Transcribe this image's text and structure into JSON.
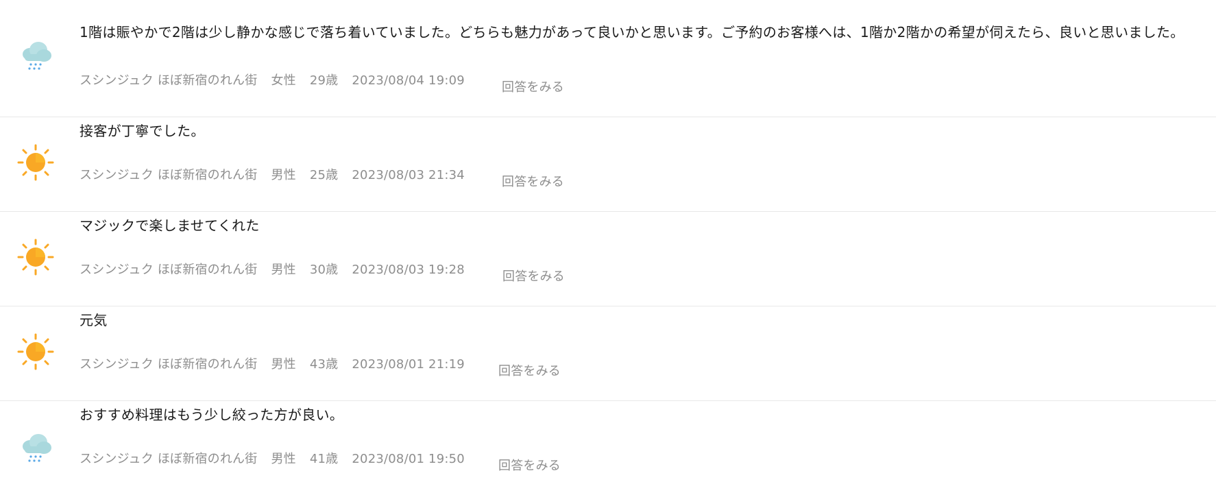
{
  "feedback": [
    {
      "weather": "rain-cloud-icon",
      "comment": "1階は賑やかで2階は少し静かな感じで落ち着いていました。どちらも魅力があって良いかと思います。ご予約のお客様へは、1階か2階かの希望が伺えたら、良いと思いました。",
      "store": "スシンジュク ほぼ新宿のれん街",
      "gender": "女性",
      "age": "29歳",
      "date": "2023/08/04 19:09",
      "answer_label": "回答をみる"
    },
    {
      "weather": "sun-icon",
      "comment": "接客が丁寧でした。",
      "store": "スシンジュク ほぼ新宿のれん街",
      "gender": "男性",
      "age": "25歳",
      "date": "2023/08/03 21:34",
      "answer_label": "回答をみる"
    },
    {
      "weather": "sun-icon",
      "comment": "マジックで楽しませてくれた",
      "store": "スシンジュク ほぼ新宿のれん街",
      "gender": "男性",
      "age": "30歳",
      "date": "2023/08/03 19:28",
      "answer_label": "回答をみる"
    },
    {
      "weather": "sun-icon",
      "comment": "元気",
      "store": "スシンジュク ほぼ新宿のれん街",
      "gender": "男性",
      "age": "43歳",
      "date": "2023/08/01 21:19",
      "answer_label": "回答をみる"
    },
    {
      "weather": "rain-cloud-icon",
      "comment": "おすすめ料理はもう少し絞った方が良い。",
      "store": "スシンジュク ほぼ新宿のれん街",
      "gender": "男性",
      "age": "41歳",
      "date": "2023/08/01 19:50",
      "answer_label": "回答をみる"
    }
  ],
  "colors": {
    "sun_core": "#f9a825",
    "sun_ray": "#f9a825",
    "cloud": "#a9d8dd",
    "rain": "#5aa9e6",
    "meta_text": "#8e8e8e",
    "comment_text": "#1a1a1a",
    "divider": "#e8e8e8"
  }
}
